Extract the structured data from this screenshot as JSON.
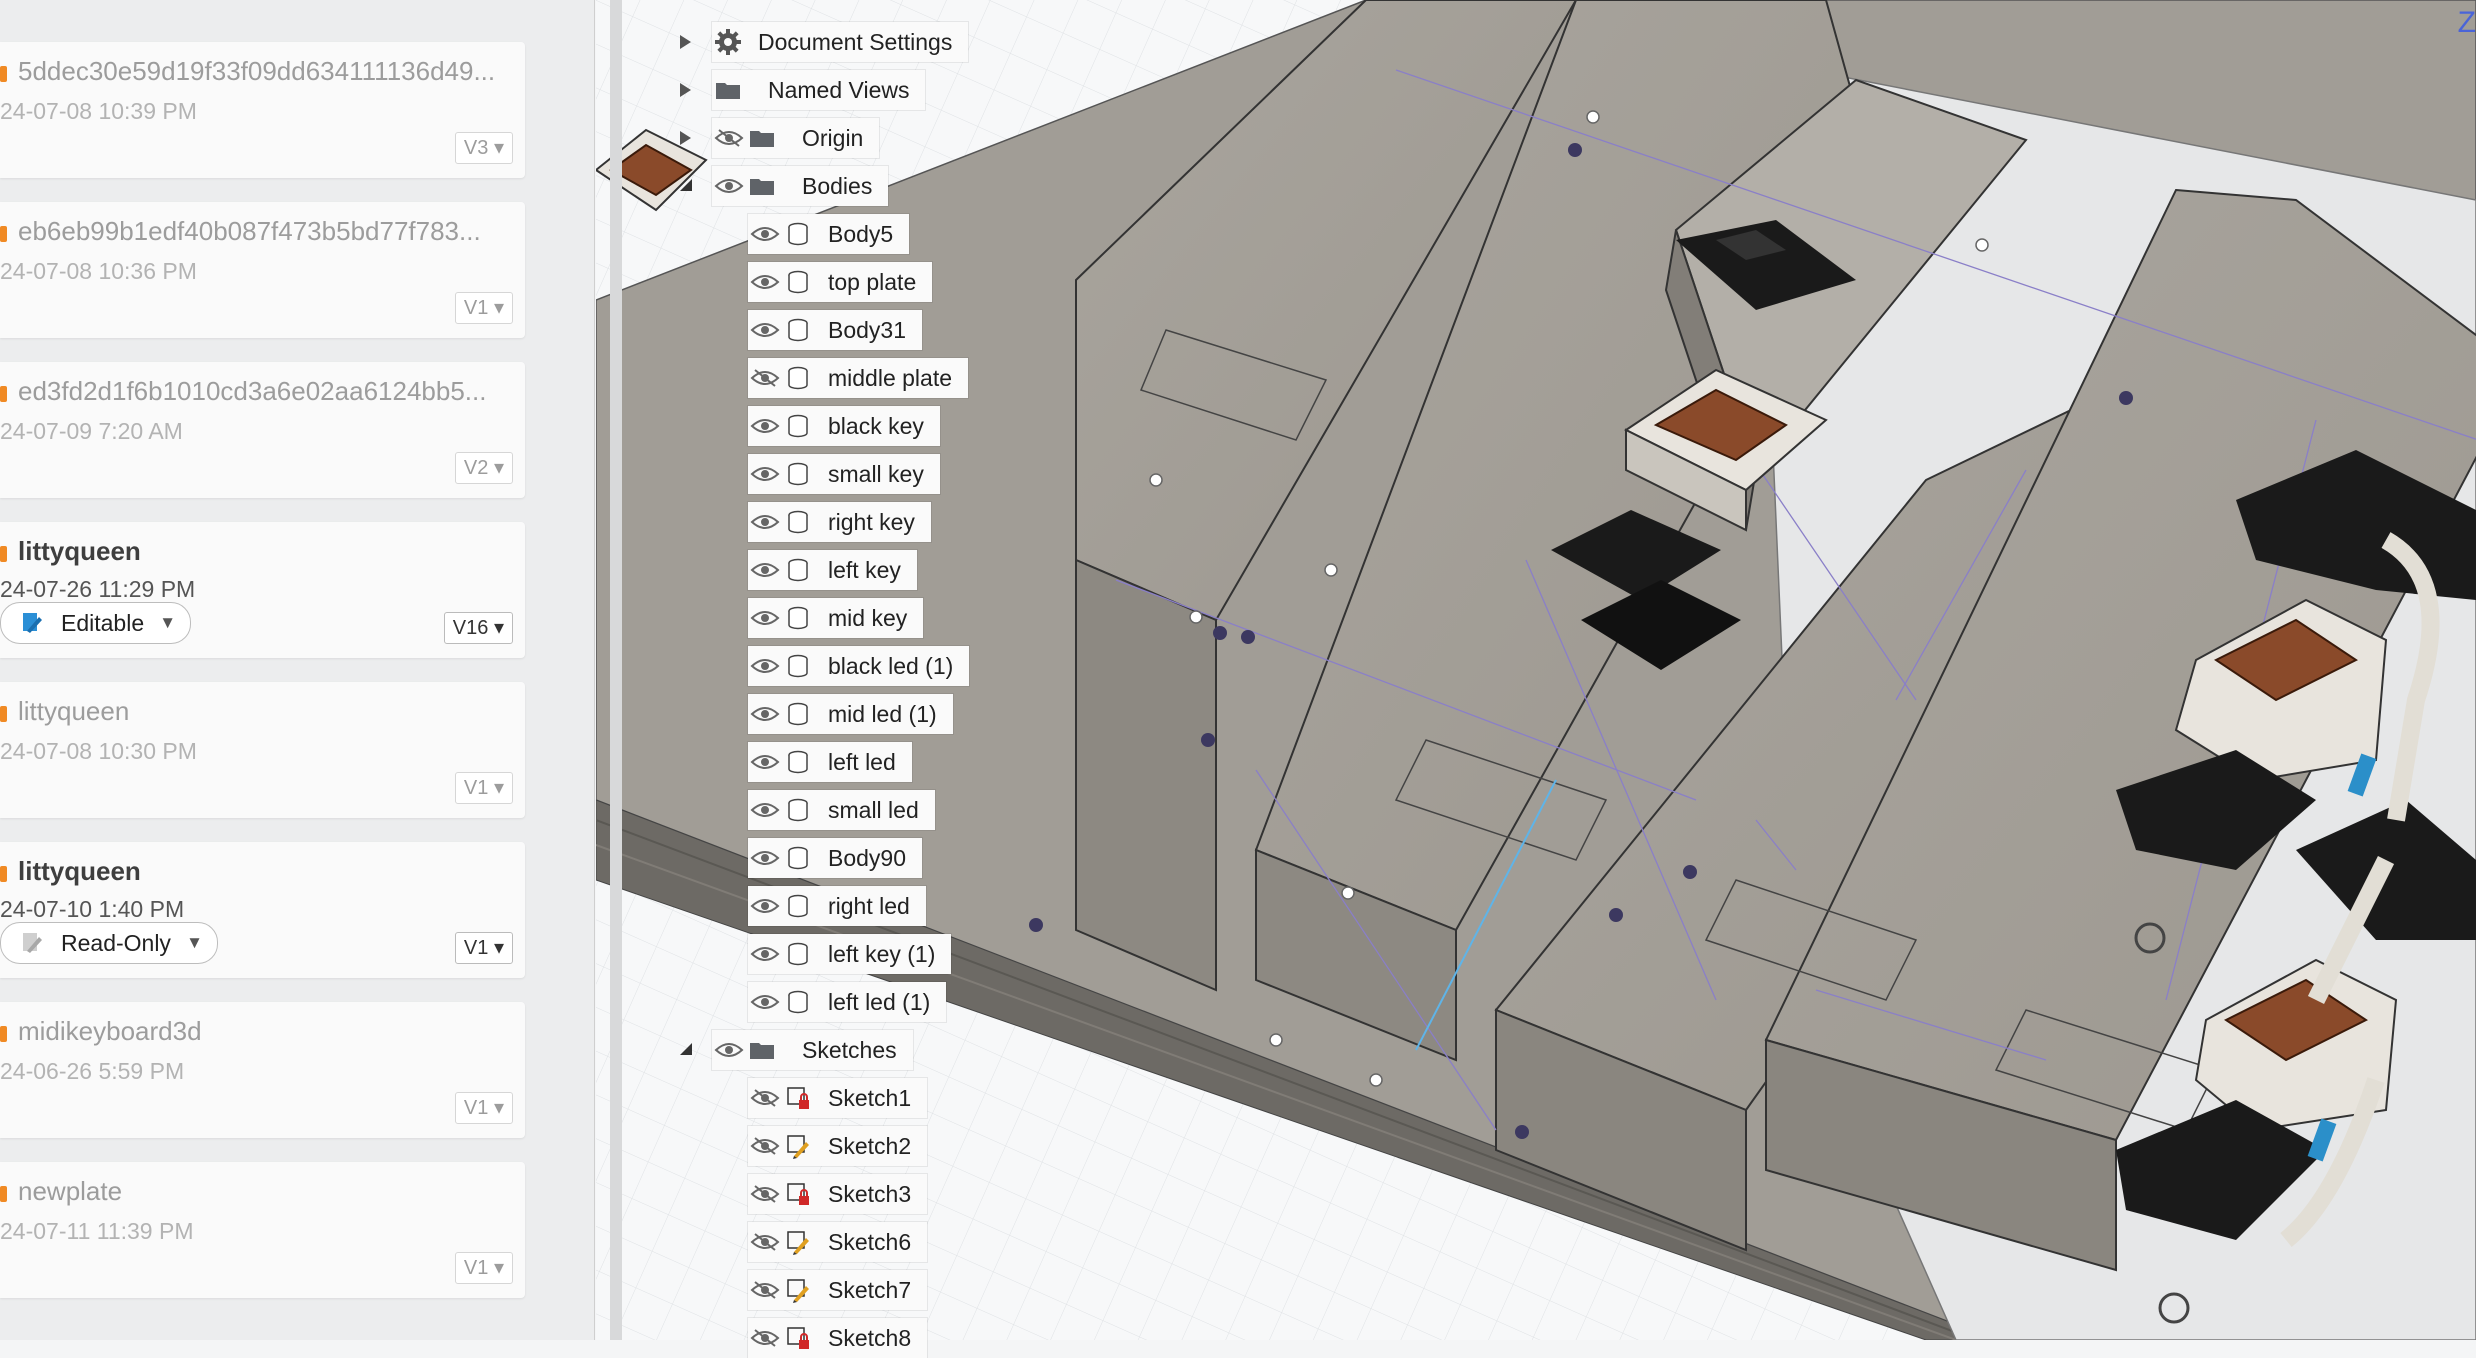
{
  "data_panel": {
    "cards": [
      {
        "title": "5ddec30e59d19f33f09dd634111136d49...",
        "date": "24-07-08 10:39 PM",
        "version": "V3",
        "active": false
      },
      {
        "title": "eb6eb99b1edf40b087f473b5bd77f783...",
        "date": "24-07-08 10:36 PM",
        "version": "V1",
        "active": false
      },
      {
        "title": "ed3fd2d1f6b1010cd3a6e02aa6124bb5...",
        "date": "24-07-09 7:20 AM",
        "version": "V2",
        "active": false
      },
      {
        "title": "littyqueen",
        "date": "24-07-26 11:29 PM",
        "version": "V16",
        "active": true,
        "permission": "Editable"
      },
      {
        "title": "littyqueen",
        "date": "24-07-08 10:30 PM",
        "version": "V1",
        "active": false
      },
      {
        "title": "littyqueen",
        "date": "24-07-10 1:40 PM",
        "version": "V1",
        "active": true,
        "permission": "Read-Only"
      },
      {
        "title": "midikeyboard3d",
        "date": "24-06-26 5:59 PM",
        "version": "V1",
        "active": false
      },
      {
        "title": "newplate",
        "date": "24-07-11 11:39 PM",
        "version": "V1",
        "active": false
      }
    ]
  },
  "browser": {
    "items": [
      {
        "label": "Document Settings",
        "icon": "gear-icon",
        "eye": "none",
        "expander": "closed",
        "level": 0
      },
      {
        "label": "Named Views",
        "icon": "folder-icon",
        "eye": "none",
        "expander": "closed",
        "level": 0
      },
      {
        "label": "Origin",
        "icon": "folder-icon",
        "eye": "hidden",
        "expander": "closed",
        "level": 0
      },
      {
        "label": "Bodies",
        "icon": "folder-icon",
        "eye": "visible",
        "expander": "open",
        "level": 0
      },
      {
        "label": "Body5",
        "icon": "body-icon",
        "eye": "visible",
        "level": 1
      },
      {
        "label": "top plate",
        "icon": "body-icon",
        "eye": "visible",
        "level": 1
      },
      {
        "label": "Body31",
        "icon": "body-icon",
        "eye": "visible",
        "level": 1
      },
      {
        "label": "middle plate",
        "icon": "body-icon",
        "eye": "hidden",
        "level": 1
      },
      {
        "label": "black key",
        "icon": "body-icon",
        "eye": "visible",
        "level": 1
      },
      {
        "label": "small key",
        "icon": "body-icon",
        "eye": "visible",
        "level": 1
      },
      {
        "label": "right key",
        "icon": "body-icon",
        "eye": "visible",
        "level": 1
      },
      {
        "label": "left key",
        "icon": "body-icon",
        "eye": "visible",
        "level": 1
      },
      {
        "label": "mid key",
        "icon": "body-icon",
        "eye": "visible",
        "level": 1
      },
      {
        "label": "black led (1)",
        "icon": "body-icon",
        "eye": "visible",
        "level": 1
      },
      {
        "label": "mid led (1)",
        "icon": "body-icon",
        "eye": "visible",
        "level": 1
      },
      {
        "label": "left led",
        "icon": "body-icon",
        "eye": "visible",
        "level": 1
      },
      {
        "label": "small led",
        "icon": "body-icon",
        "eye": "visible",
        "level": 1
      },
      {
        "label": "Body90",
        "icon": "body-icon",
        "eye": "visible",
        "level": 1
      },
      {
        "label": "right led",
        "icon": "body-icon",
        "eye": "visible",
        "level": 1
      },
      {
        "label": "left key (1)",
        "icon": "body-icon",
        "eye": "visible",
        "level": 1
      },
      {
        "label": "left led (1)",
        "icon": "body-icon",
        "eye": "visible",
        "level": 1
      },
      {
        "label": "Sketches",
        "icon": "folder-icon",
        "eye": "visible",
        "expander": "open",
        "level": 0
      },
      {
        "label": "Sketch1",
        "icon": "sketch-locked-icon",
        "eye": "hidden",
        "level": 1
      },
      {
        "label": "Sketch2",
        "icon": "sketch-edit-icon",
        "eye": "hidden",
        "level": 1
      },
      {
        "label": "Sketch3",
        "icon": "sketch-locked-icon",
        "eye": "hidden",
        "level": 1
      },
      {
        "label": "Sketch6",
        "icon": "sketch-edit-icon",
        "eye": "hidden",
        "level": 1
      },
      {
        "label": "Sketch7",
        "icon": "sketch-edit-icon",
        "eye": "hidden",
        "level": 1
      },
      {
        "label": "Sketch8",
        "icon": "sketch-locked-icon",
        "eye": "hidden",
        "level": 1
      }
    ]
  },
  "viewport": {
    "nav_label": "Z"
  }
}
